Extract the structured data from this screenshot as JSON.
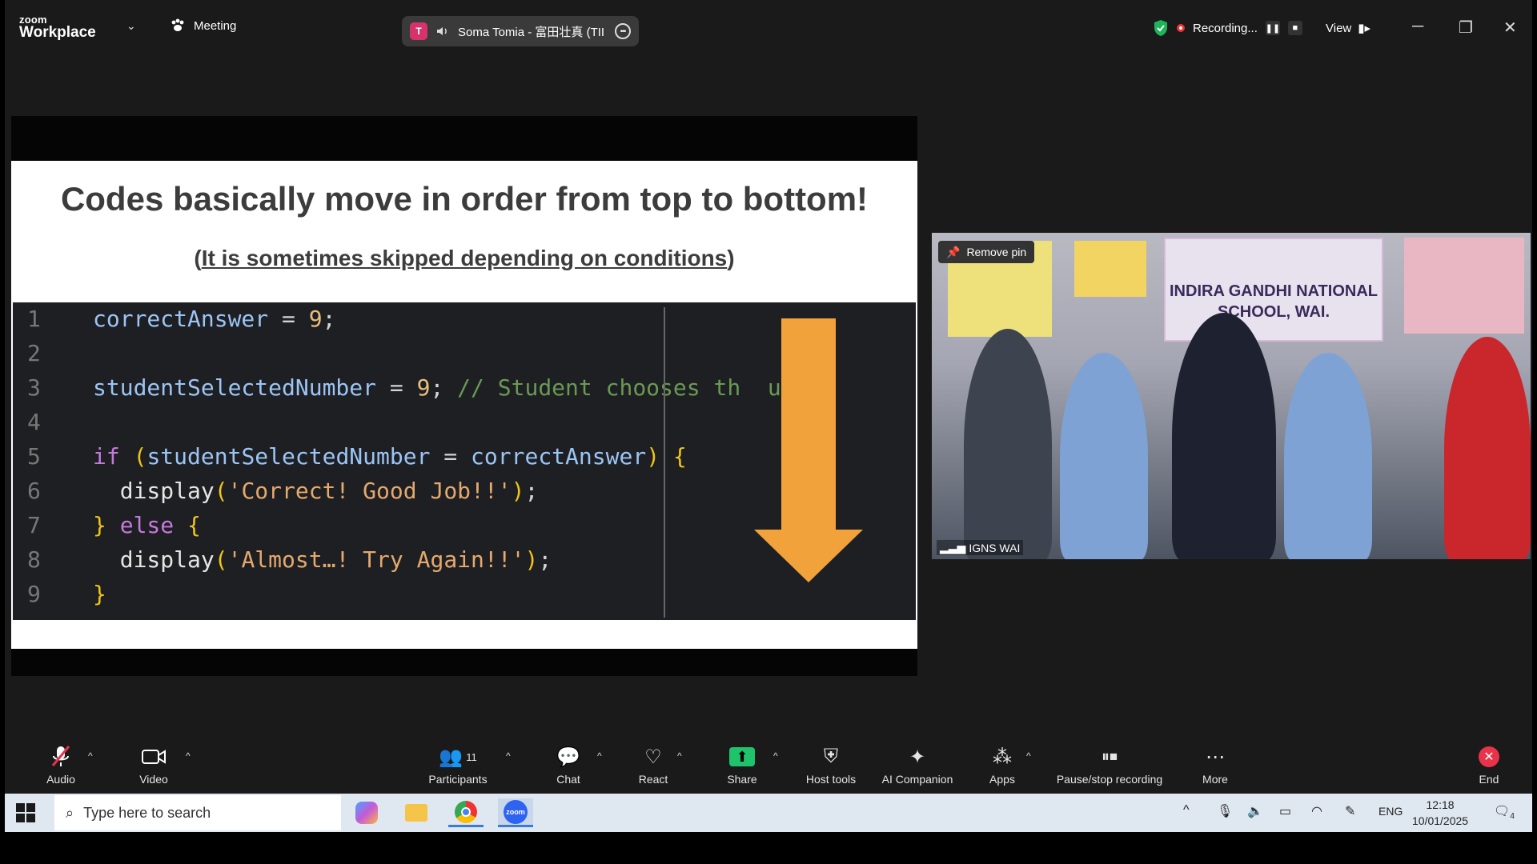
{
  "app": {
    "logo_line1": "zoom",
    "logo_line2": "Workplace",
    "meeting_label": "Meeting"
  },
  "active_speaker": {
    "initial": "T",
    "name": "Soma Tomia - 富田壮真 (TII"
  },
  "status": {
    "recording_label": "Recording...",
    "view_label": "View"
  },
  "slide": {
    "title": "Codes basically move in order from top to bottom!",
    "subtitle_open": "(",
    "subtitle_text": "It is sometimes skipped depending on conditions",
    "subtitle_close": ")",
    "code_lines": [
      {
        "n": "1",
        "parts": [
          [
            "v",
            "correctAnswer"
          ],
          [
            "op",
            " = "
          ],
          [
            "num",
            "9"
          ],
          [
            "op",
            ";"
          ]
        ]
      },
      {
        "n": "2",
        "parts": []
      },
      {
        "n": "3",
        "parts": [
          [
            "v",
            "studentSelectedNumber"
          ],
          [
            "op",
            " = "
          ],
          [
            "num",
            "9"
          ],
          [
            "op",
            "; "
          ],
          [
            "cm",
            "// Student chooses th  umber"
          ]
        ]
      },
      {
        "n": "4",
        "parts": []
      },
      {
        "n": "5",
        "parts": [
          [
            "kw",
            "if "
          ],
          [
            "br",
            "("
          ],
          [
            "v",
            "studentSelectedNumber"
          ],
          [
            "op",
            " = "
          ],
          [
            "v",
            "correctAnswer"
          ],
          [
            "br",
            ")"
          ],
          [
            "op",
            " "
          ],
          [
            "br",
            "{"
          ]
        ]
      },
      {
        "n": "6",
        "parts": [
          [
            "op",
            "  "
          ],
          [
            "fn",
            "display"
          ],
          [
            "br",
            "("
          ],
          [
            "str",
            "'Correct! Good Job!!'"
          ],
          [
            "br",
            ")"
          ],
          [
            "op",
            ";"
          ]
        ]
      },
      {
        "n": "7",
        "parts": [
          [
            "br",
            "}"
          ],
          [
            "kw",
            " else "
          ],
          [
            "br",
            "{"
          ]
        ]
      },
      {
        "n": "8",
        "parts": [
          [
            "op",
            "  "
          ],
          [
            "fn",
            "display"
          ],
          [
            "br",
            "("
          ],
          [
            "str",
            "'Almost…! Try Again!!'"
          ],
          [
            "br",
            ")"
          ],
          [
            "op",
            ";"
          ]
        ]
      },
      {
        "n": "9",
        "parts": [
          [
            "br",
            "}"
          ]
        ]
      }
    ]
  },
  "video": {
    "remove_pin": "Remove pin",
    "participant_name": "IGNS WAI",
    "banner_text": "INDIRA GANDHI NATIONAL SCHOOL, WAI."
  },
  "toolbar": {
    "audio": "Audio",
    "video": "Video",
    "participants": "Participants",
    "participant_count": "11",
    "chat": "Chat",
    "react": "React",
    "share": "Share",
    "host_tools": "Host tools",
    "ai_companion": "AI Companion",
    "apps": "Apps",
    "pause_stop": "Pause/stop recording",
    "more": "More",
    "end": "End"
  },
  "taskbar": {
    "search_placeholder": "Type here to search",
    "lang": "ENG",
    "time": "12:18",
    "date": "10/01/2025",
    "notif_count": "4"
  },
  "colors": {
    "arrow": "#f2a23a",
    "share_green": "#1ec36b",
    "end_red": "#e8334a",
    "shield_green": "#1fb45a"
  }
}
